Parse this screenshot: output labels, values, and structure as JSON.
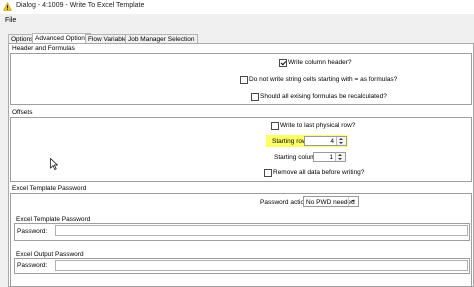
{
  "window": {
    "title": "Dialog - 4:1009 - Write To Excel Template",
    "app_icon": "knime-warning-icon",
    "accent": "#f5c400"
  },
  "menu": {
    "file": "File"
  },
  "tabs": [
    {
      "label": "Options",
      "active": false
    },
    {
      "label": "Advanced Options",
      "active": true
    },
    {
      "label": "Flow Variables",
      "active": false
    },
    {
      "label": "Job Manager Selection",
      "active": false
    }
  ],
  "header_formulas": {
    "title": "Header and Formulas",
    "write_column_header": {
      "label": "Write column header?",
      "checked": true
    },
    "no_formula_strings": {
      "label": "Do not write string cells starting with = as formulas?",
      "checked": false
    },
    "recalculate_formulas": {
      "label": "Should all exising formulas be recalculated?",
      "checked": false
    }
  },
  "offsets": {
    "title": "Offsets",
    "write_last_row": {
      "label": "Write to last physical row?",
      "checked": false
    },
    "starting_row": {
      "label": "Starting row",
      "value": "4",
      "highlight": "#ffff66"
    },
    "starting_column": {
      "label": "Starting column",
      "value": "1"
    },
    "remove_all_data": {
      "label": "Remove all data before writing?",
      "checked": false
    }
  },
  "template_password": {
    "title": "Excel Template Password",
    "password_action_label": "Password action",
    "password_action_value": "No PWD needed",
    "template_group_title": "Excel Template Password",
    "template_password_label": "Password:",
    "output_group_title": "Excel Output Password",
    "output_password_label": "Password:"
  }
}
